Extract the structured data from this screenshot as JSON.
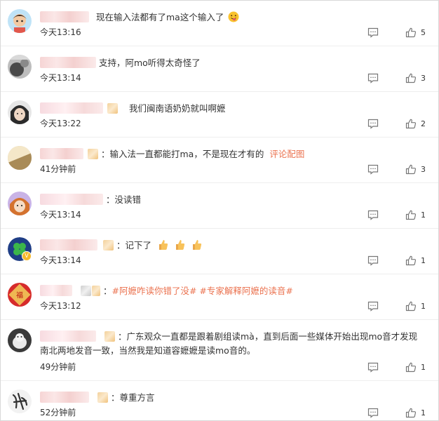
{
  "comments": [
    {
      "avatar": "blue-cartoon-avatar",
      "name_width": 70,
      "colon": "",
      "text": "现在输入法都有了ma这个输入了",
      "emoji": "tongue-face",
      "time": "今天13:16",
      "likes": "5"
    },
    {
      "avatar": "gray-photo-avatar",
      "name_width": 80,
      "colon": "",
      "text": "支持，阿mo听得太奇怪了",
      "time": "今天13:14",
      "likes": "3"
    },
    {
      "avatar": "girl-photo-avatar",
      "name_width": 90,
      "medal": true,
      "colon": "",
      "text": "我们闽南语奶奶就叫啊嬷",
      "time": "今天13:22",
      "likes": "2"
    },
    {
      "avatar": "sunset-avatar",
      "name_width": 62,
      "medal": true,
      "colon": "：",
      "text": "输入法一直都能打ma，不是现在才有的",
      "link": "评论配图",
      "time": "41分钟前",
      "likes": "3"
    },
    {
      "avatar": "cartoon-girl-avatar",
      "name_width": 90,
      "colon": "：",
      "text": "没读错",
      "time": "今天13:14",
      "likes": "1"
    },
    {
      "avatar": "clover-avatar",
      "name_width": 82,
      "medal": true,
      "colon": "：",
      "text": "记下了",
      "emoji_thumbs": [
        "thumbs-up-emoji",
        "thumbs-up-emoji",
        "thumbs-up-emoji"
      ],
      "time": "今天13:14",
      "likes": "1"
    },
    {
      "avatar": "red-festive-avatar",
      "name_width": 46,
      "medal": true,
      "medal2": true,
      "colon": "：",
      "topics": [
        "#阿嬷咋读你错了没#",
        "#专家解释阿嬷的读音#"
      ],
      "time": "今天13:12",
      "likes": "1"
    },
    {
      "avatar": "dark-photo-avatar",
      "name_width": 80,
      "medal": true,
      "colon": "：",
      "text": "广东观众一直都是跟着剧组读mà，直到后面一些媒体开始出现mo音才发现南北两地发音一致，当然我是知道容嬷嬷是读mo音的。",
      "time": "49分钟前",
      "likes": "1"
    },
    {
      "avatar": "calligraphy-avatar",
      "name_width": 70,
      "medal": true,
      "colon": "：",
      "text": "尊重方言",
      "time": "52分钟前",
      "likes": "1"
    }
  ]
}
